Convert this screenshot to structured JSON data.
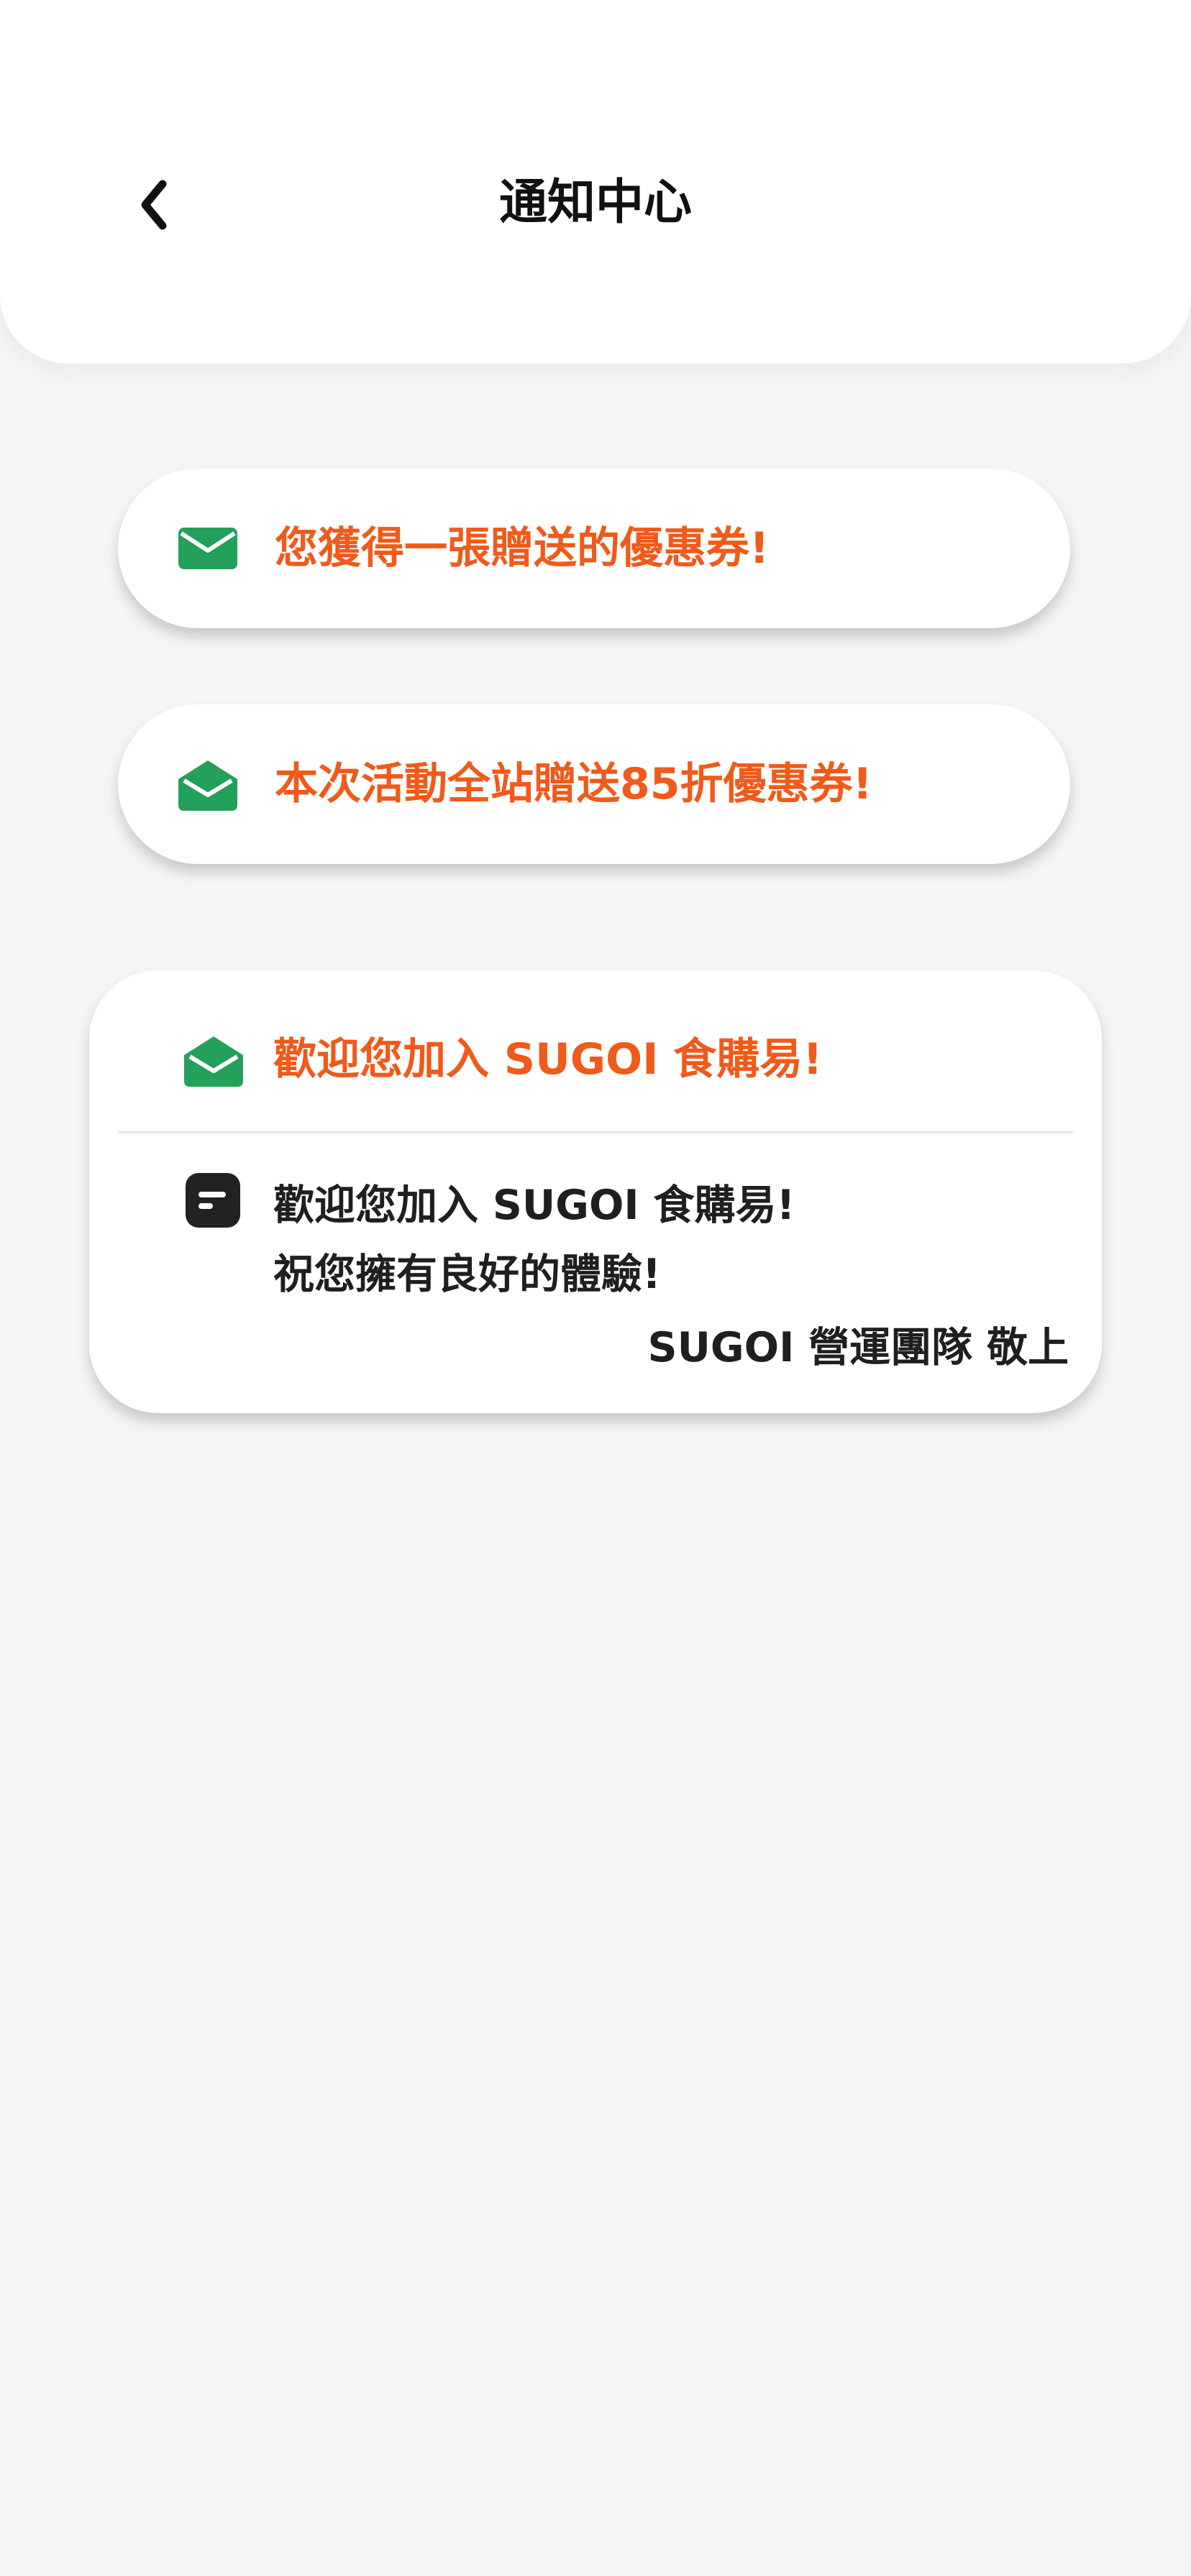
{
  "header": {
    "title": "通知中心",
    "back_icon": "chevron-left-icon"
  },
  "notifications": [
    {
      "title": "您獲得一張贈送的優惠券!",
      "icon": "envelope-closed-icon",
      "expanded": false,
      "title_color": "#f05a1a",
      "icon_color": "#23a05a"
    },
    {
      "title": "本次活動全站贈送85折優惠券!",
      "icon": "envelope-open-icon",
      "expanded": false,
      "title_color": "#f05a1a",
      "icon_color": "#23a05a"
    },
    {
      "title": "歡迎您加入 SUGOI 食購易!",
      "icon": "envelope-open-icon",
      "expanded": true,
      "body_icon": "message-icon",
      "body_lines": [
        "歡迎您加入 SUGOI 食購易!",
        "祝您擁有良好的體驗!"
      ],
      "signature": "SUGOI 營運團隊 敬上",
      "title_color": "#f05a1a",
      "icon_color": "#23a05a"
    }
  ]
}
